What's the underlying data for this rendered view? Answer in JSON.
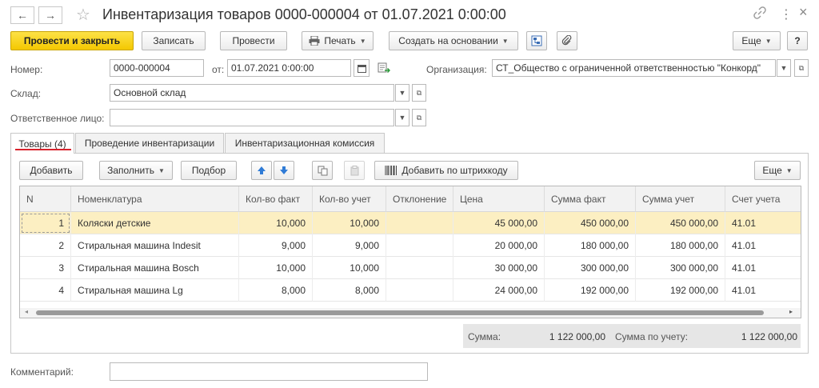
{
  "window": {
    "title": "Инвентаризация товаров 0000-000004 от 01.07.2021 0:00:00",
    "back_glyph": "←",
    "forward_glyph": "→",
    "star_glyph": "☆",
    "link_glyph": "🔗",
    "more_glyph": "⋮",
    "close_glyph": "×"
  },
  "toolbar": {
    "post_close": "Провести и закрыть",
    "save": "Записать",
    "post": "Провести",
    "print": "Печать",
    "create_based": "Создать на основании",
    "more": "Еще",
    "help": "?"
  },
  "form": {
    "number_label": "Номер:",
    "number_value": "0000-000004",
    "date_label": "от:",
    "date_value": "01.07.2021  0:00:00",
    "org_label": "Организация:",
    "org_value": "СТ_Общество с ограниченной ответственностью \"Конкорд\"",
    "warehouse_label": "Склад:",
    "warehouse_value": "Основной склад",
    "responsible_label": "Ответственное лицо:",
    "responsible_value": "",
    "comment_label": "Комментарий:",
    "comment_value": ""
  },
  "tabs": [
    {
      "label": "Товары (4)",
      "active": true
    },
    {
      "label": "Проведение инвентаризации",
      "active": false
    },
    {
      "label": "Инвентаризационная комиссия",
      "active": false
    }
  ],
  "table_toolbar": {
    "add": "Добавить",
    "fill": "Заполнить",
    "select": "Подбор",
    "add_barcode": "Добавить по штрихкоду",
    "more": "Еще"
  },
  "table": {
    "columns": [
      "N",
      "Номенклатура",
      "Кол-во факт",
      "Кол-во учет",
      "Отклонение",
      "Цена",
      "Сумма факт",
      "Сумма учет",
      "Счет учета"
    ],
    "rows": [
      {
        "n": "1",
        "item": "Коляски детские",
        "qty_fact": "10,000",
        "qty_acc": "10,000",
        "dev": "",
        "price": "45 000,00",
        "sum_fact": "450 000,00",
        "sum_acc": "450 000,00",
        "account": "41.01"
      },
      {
        "n": "2",
        "item": "Стиральная машина Indesit",
        "qty_fact": "9,000",
        "qty_acc": "9,000",
        "dev": "",
        "price": "20 000,00",
        "sum_fact": "180 000,00",
        "sum_acc": "180 000,00",
        "account": "41.01"
      },
      {
        "n": "3",
        "item": "Стиральная машина Bosch",
        "qty_fact": "10,000",
        "qty_acc": "10,000",
        "dev": "",
        "price": "30 000,00",
        "sum_fact": "300 000,00",
        "sum_acc": "300 000,00",
        "account": "41.01"
      },
      {
        "n": "4",
        "item": "Стиральная машина Lg",
        "qty_fact": "8,000",
        "qty_acc": "8,000",
        "dev": "",
        "price": "24 000,00",
        "sum_fact": "192 000,00",
        "sum_acc": "192 000,00",
        "account": "41.01"
      }
    ]
  },
  "totals": {
    "sum_label": "Сумма:",
    "sum_value": "1 122 000,00",
    "acc_label": "Сумма по учету:",
    "acc_value": "1 122 000,00"
  },
  "colors": {
    "primary_button": "#f4c800",
    "selected_row": "#fcefc2",
    "active_tab_underline": "#d9232d"
  }
}
